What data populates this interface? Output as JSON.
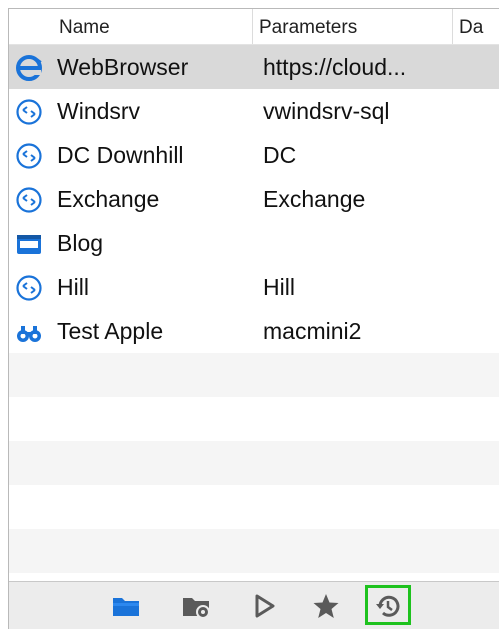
{
  "columns": {
    "name": "Name",
    "parameters": "Parameters",
    "date": "Da"
  },
  "rows": [
    {
      "name": "WebBrowser",
      "param": "https://cloud...",
      "icon": "web-browser-icon"
    },
    {
      "name": "Windsrv",
      "param": "vwindsrv-sql",
      "icon": "remote-desktop-icon"
    },
    {
      "name": "DC Downhill",
      "param": "DC",
      "icon": "remote-desktop-icon"
    },
    {
      "name": "Exchange",
      "param": "Exchange",
      "icon": "remote-desktop-icon"
    },
    {
      "name": "Blog",
      "param": "",
      "icon": "ftp-folder-icon"
    },
    {
      "name": "Hill",
      "param": "Hill",
      "icon": "remote-desktop-icon"
    },
    {
      "name": "Test Apple",
      "param": "macmini2",
      "icon": "screen-sharing-icon"
    }
  ],
  "selected_row": "WebBrowser",
  "toolbar": {
    "buttons": [
      "folder-icon",
      "folder-gear-icon",
      "play-icon",
      "star-icon",
      "history-icon"
    ],
    "highlighted": "history-icon"
  },
  "colors": {
    "accent_blue": "#1a73d9",
    "highlight_green": "#1ec21e",
    "toolbar_icon_gray": "#5a5a5a"
  }
}
